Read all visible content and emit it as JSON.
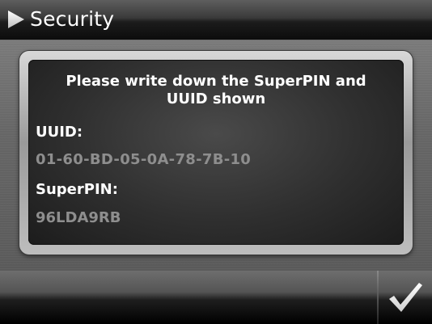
{
  "header": {
    "title": "Security",
    "arrow_icon": "play-triangle-icon"
  },
  "dialog": {
    "message": "Please write down the SuperPIN and\nUUID shown",
    "uuid_label": "UUID:",
    "uuid_value": "01-60-BD-05-0A-78-7B-10",
    "superpin_label": "SuperPIN:",
    "superpin_value": "96LDA9RB"
  },
  "footer": {
    "confirm_icon": "checkmark-icon"
  },
  "colors": {
    "title_text": "#ffffff",
    "label_text": "#ffffff",
    "value_text": "#8e8e8e",
    "dialog_bg": "#2f2f2f"
  }
}
